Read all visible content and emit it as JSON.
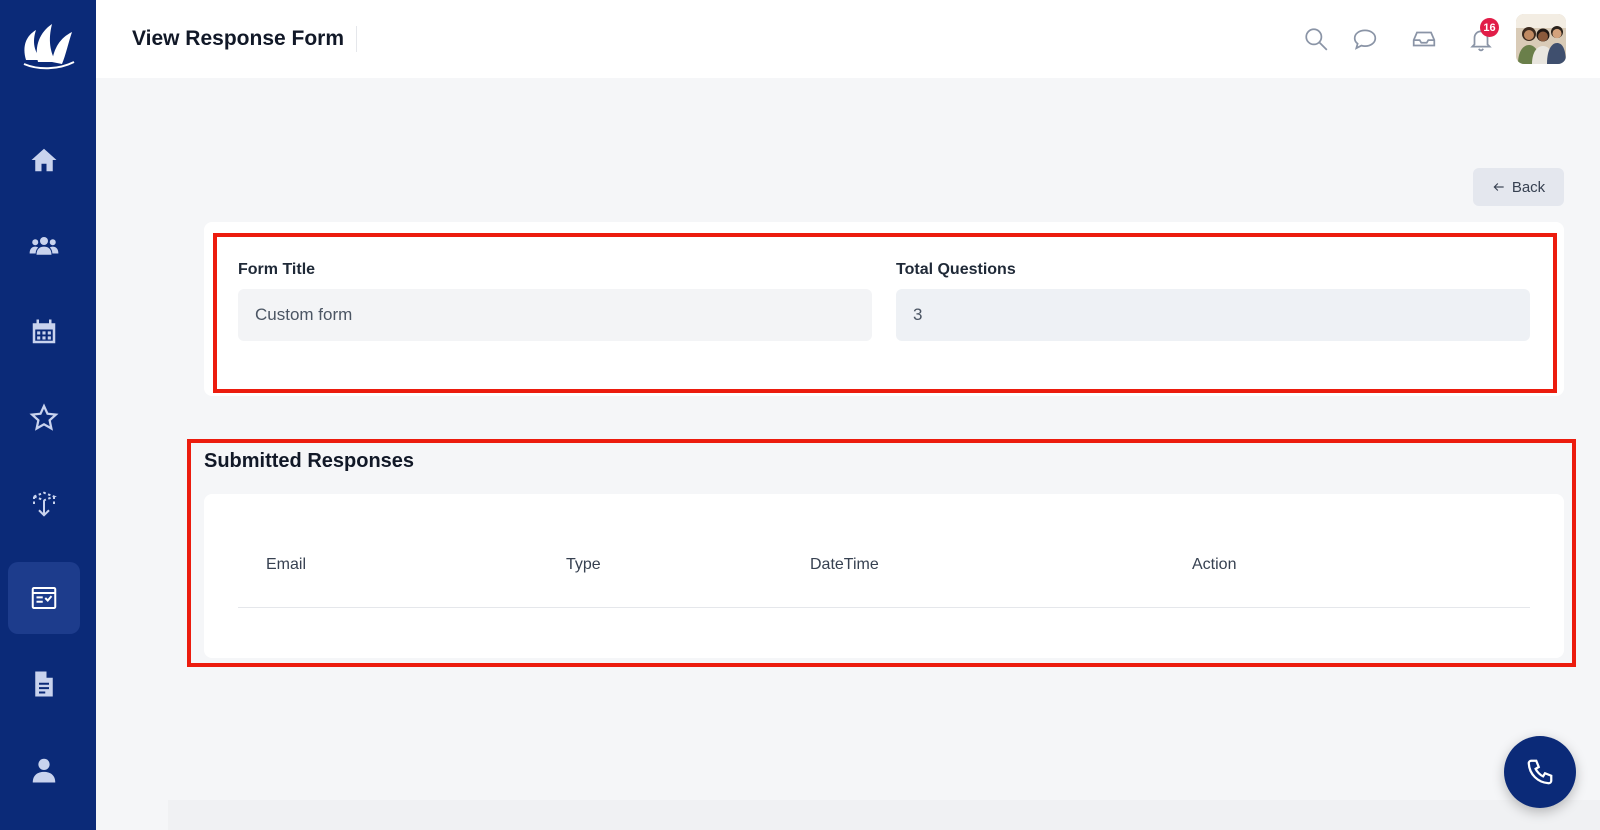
{
  "header": {
    "title": "View Response Form",
    "notification_count": "16"
  },
  "sidebar": {
    "items": [
      {
        "icon": "home-icon",
        "active": false
      },
      {
        "icon": "users-icon",
        "active": false
      },
      {
        "icon": "calendar-icon",
        "active": false
      },
      {
        "icon": "star-icon",
        "active": false
      },
      {
        "icon": "box-arrow-icon",
        "active": false
      },
      {
        "icon": "form-list-icon",
        "active": true
      },
      {
        "icon": "document-icon",
        "active": false
      },
      {
        "icon": "user-icon",
        "active": false
      }
    ]
  },
  "toolbar": {
    "back_label": "Back"
  },
  "form": {
    "title_label": "Form Title",
    "title_value": "Custom form",
    "questions_label": "Total Questions",
    "questions_value": "3"
  },
  "responses": {
    "section_title": "Submitted Responses",
    "columns": [
      "Email",
      "Type",
      "DateTime",
      "Action"
    ],
    "rows": []
  },
  "colors": {
    "sidebar": "#0b2a78",
    "highlight": "#ec1c0e",
    "badge": "#e11d48"
  }
}
